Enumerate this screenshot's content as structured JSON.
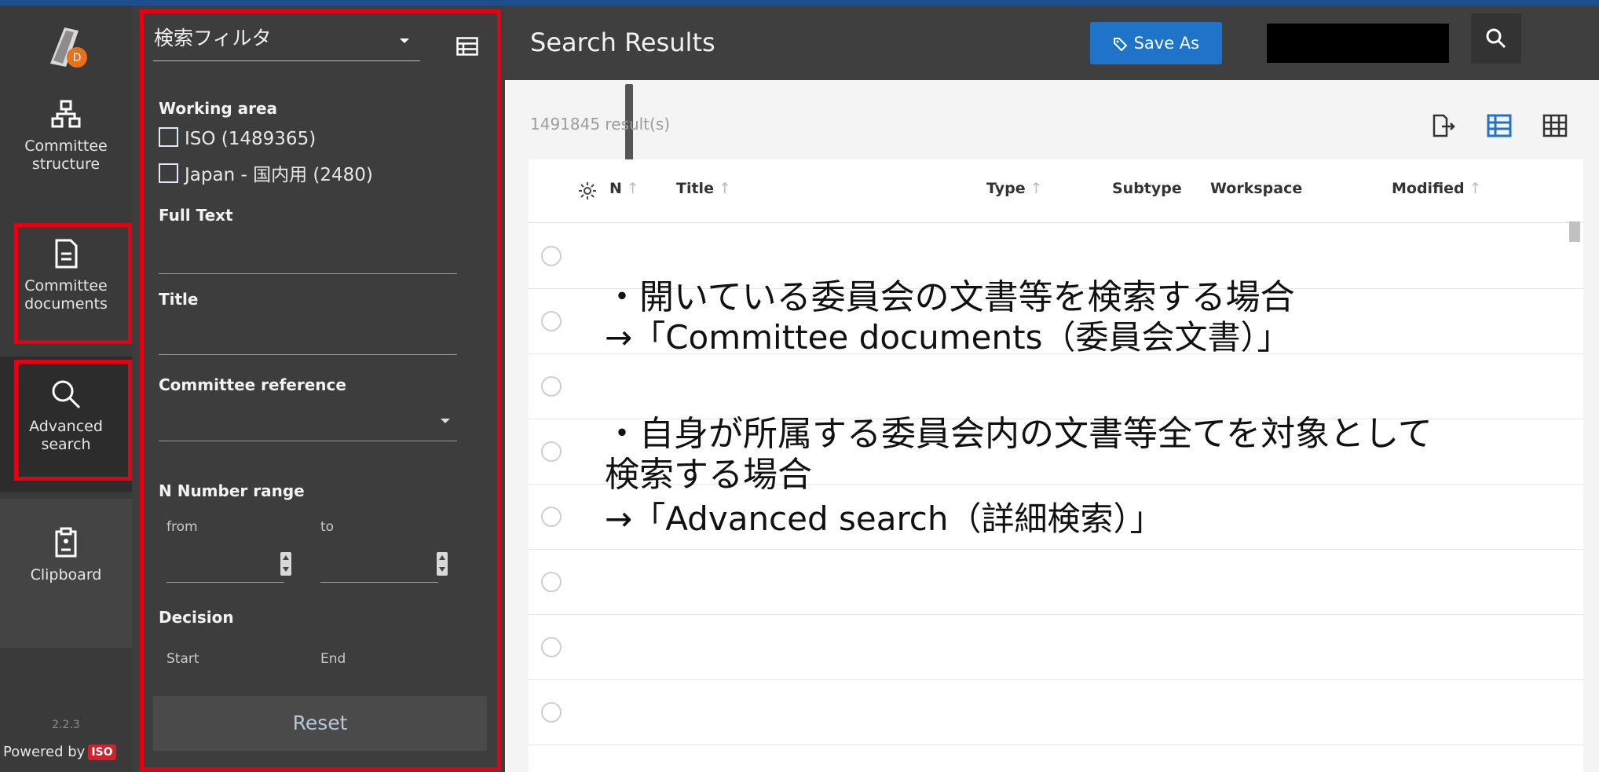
{
  "rail": {
    "items": [
      {
        "label_lines": [
          "Committee",
          "structure"
        ],
        "icon": "hierarchy-icon"
      },
      {
        "label_lines": [
          "Committee",
          "documents"
        ],
        "icon": "document-icon"
      },
      {
        "label_lines": [
          "Advanced",
          "search"
        ],
        "icon": "search-icon"
      },
      {
        "label_lines": [
          "Clipboard"
        ],
        "icon": "clipboard-icon"
      }
    ],
    "version": "2.2.3",
    "powered_by": "Powered by",
    "powered_badge": "ISO"
  },
  "filter": {
    "selector_label": "検索フィルタ",
    "working_area_label": "Working area",
    "options": [
      "ISO (1489365)",
      "Japan - 国内用 (2480)"
    ],
    "full_text_label": "Full Text",
    "title_label": "Title",
    "committee_reference_label": "Committee reference",
    "n_number_range_label": "N Number range",
    "from_label": "from",
    "to_label": "to",
    "decision_label": "Decision",
    "start_label": "Start",
    "end_label": "End",
    "reset_label": "Reset"
  },
  "header": {
    "title": "Search Results",
    "save_as_label": "Save As"
  },
  "results": {
    "count_text": "1491845 result(s)",
    "columns": [
      "N",
      "Title",
      "Type",
      "Subtype",
      "Workspace",
      "Modified"
    ]
  },
  "overlay": {
    "line1": "・開いている委員会の文書等を検索する場合",
    "line2": "→「Committee documents（委員会文書）」",
    "line3": "・自身が所属する委員会内の文書等全てを対象として",
    "line4": "検索する場合",
    "line5": "→「Advanced search（詳細検索）」"
  },
  "colors": {
    "highlight": "#e60012",
    "save_button": "#1f73c9",
    "accent_blue": "#1f73c9"
  }
}
